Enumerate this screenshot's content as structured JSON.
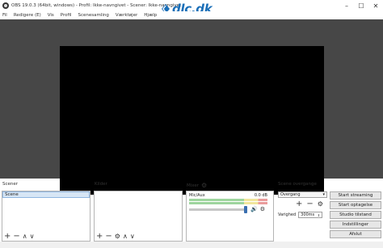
{
  "window": {
    "title": "OBS 19.0.3 (64bit, windows) - Profil: Ikke-navngivet - Scener: Ikke-navngivet",
    "minimize": "–",
    "maximize": "☐",
    "close": "✕"
  },
  "watermark": {
    "text": "dlc.dk"
  },
  "menu": {
    "items": [
      "Fil",
      "Redigere (E)",
      "Vis",
      "Profil",
      "Scenesamling",
      "Værktøjer",
      "Hjælp"
    ]
  },
  "scenes": {
    "label": "Scener",
    "items": [
      "Scene"
    ]
  },
  "sources": {
    "label": "Kilder"
  },
  "mixer": {
    "label": "Mixer",
    "track_name": "Mic/Aux",
    "track_level": "0.0 dB",
    "fader_level": 1.0
  },
  "transitions": {
    "label": "Scene overgange",
    "selected": "Overgang",
    "duration_label": "Varighed",
    "duration_value": "300ms"
  },
  "controls": {
    "start_streaming": "Start streaming",
    "start_recording": "Start optagelse",
    "studio_mode": "Studio tilstand",
    "settings": "Indstillinger",
    "exit": "Afslut"
  },
  "icons": {
    "add": "+",
    "remove": "−",
    "up": "∧",
    "down": "∨",
    "gear": "⚙",
    "speaker": "🔊"
  }
}
